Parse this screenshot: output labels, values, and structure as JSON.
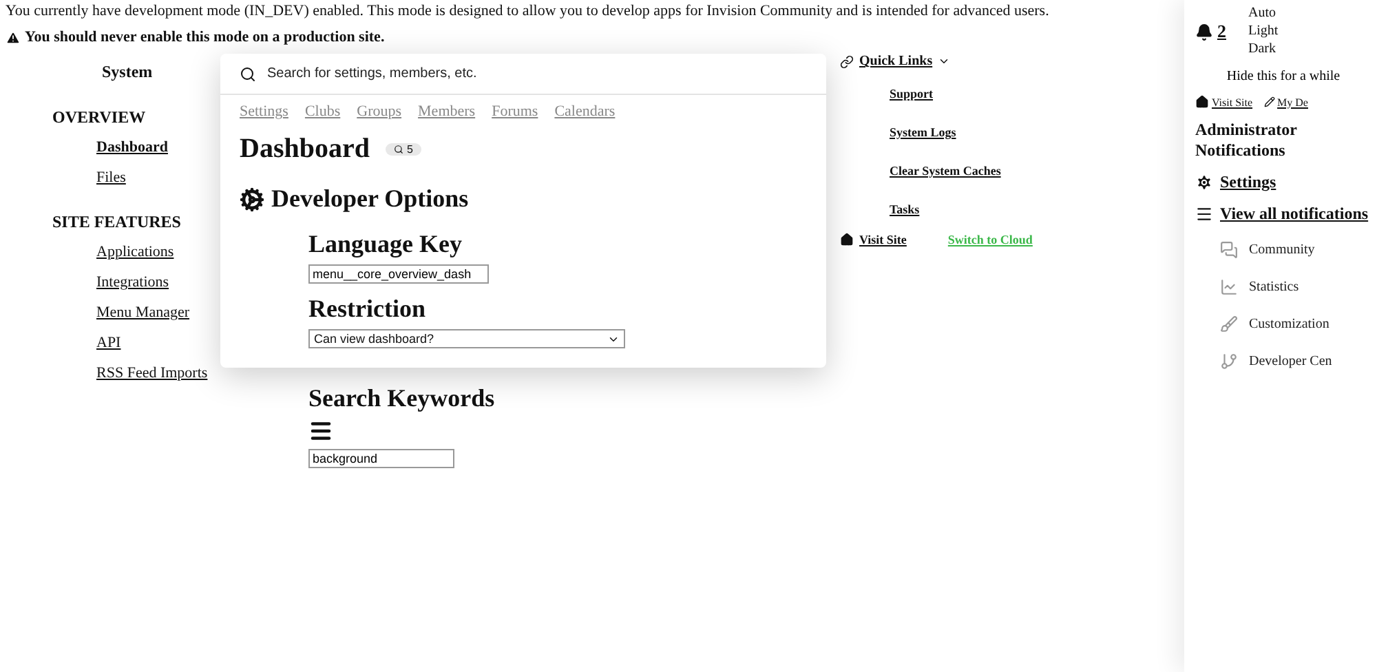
{
  "banner": {
    "message": "You currently have development mode (IN_DEV) enabled. This mode is designed to allow you to develop apps for Invision Community and is intended for advanced users.",
    "warning": "You should never enable this mode on a production site."
  },
  "sidebar": {
    "title": "System",
    "sections": [
      {
        "label": "OVERVIEW",
        "children": [
          {
            "label": "Dashboard",
            "selected": true
          },
          {
            "label": "Files",
            "selected": false
          }
        ]
      },
      {
        "label": "SITE FEATURES",
        "children": [
          {
            "label": "Applications",
            "selected": false
          },
          {
            "label": "Integrations",
            "selected": false
          },
          {
            "label": "Menu Manager",
            "selected": false
          },
          {
            "label": "API",
            "selected": false
          },
          {
            "label": "RSS Feed Imports",
            "selected": false
          }
        ]
      }
    ]
  },
  "search": {
    "placeholder": "Search for settings, members, etc."
  },
  "search_tabs": [
    "Settings",
    "Clubs",
    "Groups",
    "Members",
    "Forums",
    "Calendars"
  ],
  "page": {
    "title": "Dashboard",
    "count": "5",
    "section_title": "Developer Options",
    "fields": [
      {
        "kind": "text",
        "label": "Language Key",
        "value": "menu__core_overview_dash"
      },
      {
        "kind": "select",
        "label": "Restriction",
        "value": "Can view dashboard?"
      }
    ]
  },
  "keywords": {
    "label": "Search Keywords",
    "value": "background"
  },
  "quick_links": {
    "label": "Quick Links",
    "items": [
      "Support",
      "System Logs",
      "Clear System Caches",
      "Tasks"
    ]
  },
  "header_links": [
    {
      "kind": "home",
      "label": "Visit Site"
    },
    {
      "kind": "cloud",
      "label": "Switch to Cloud"
    }
  ],
  "notifications": {
    "count": "2",
    "dismiss": "Hide this for a while",
    "title": "Administrator Notifications",
    "settings": "Settings",
    "view_all": "View all notifications"
  },
  "theme_options": [
    "Auto",
    "Light",
    "Dark"
  ],
  "user_links": [
    {
      "kind": "home",
      "label": "Visit Site"
    },
    {
      "kind": "edit",
      "label": "My De"
    }
  ],
  "apps": [
    {
      "kind": "community",
      "label": "Community"
    },
    {
      "kind": "statistics",
      "label": "Statistics"
    },
    {
      "kind": "customization",
      "label": "Customization"
    },
    {
      "kind": "developer",
      "label": "Developer Cen"
    }
  ]
}
